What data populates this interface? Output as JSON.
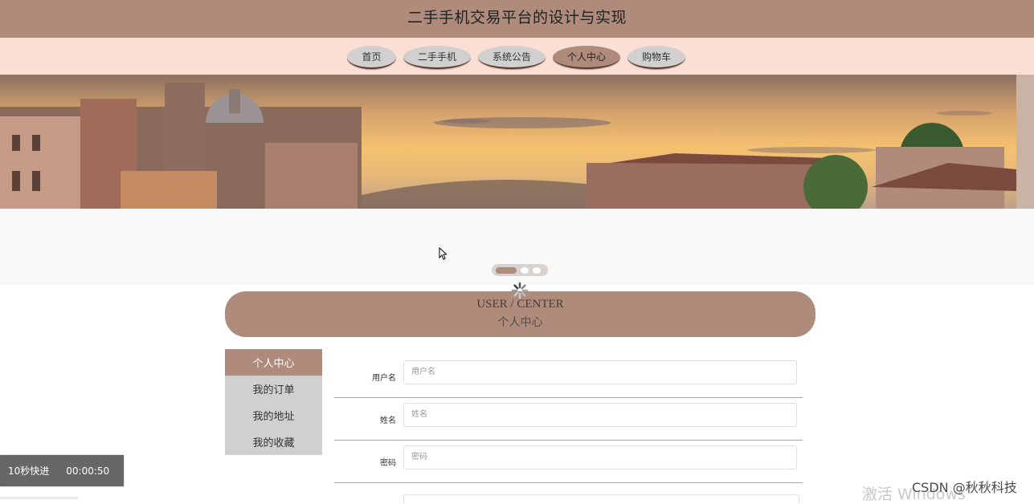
{
  "header": {
    "title": "二手手机交易平台的设计与实现"
  },
  "nav": {
    "items": [
      {
        "label": "首页"
      },
      {
        "label": "二手手机"
      },
      {
        "label": "系统公告"
      },
      {
        "label": "个人中心",
        "active": true
      },
      {
        "label": "购物车"
      }
    ]
  },
  "carousel": {
    "slide_count": 3,
    "active_index": 0
  },
  "section": {
    "title_en": "USER / CENTER",
    "title_cn": "个人中心"
  },
  "sidebar": {
    "items": [
      {
        "label": "个人中心",
        "active": true
      },
      {
        "label": "我的订单"
      },
      {
        "label": "我的地址"
      },
      {
        "label": "我的收藏"
      }
    ]
  },
  "form": {
    "fields": [
      {
        "label": "用户名",
        "placeholder": "用户名"
      },
      {
        "label": "姓名",
        "placeholder": "姓名"
      },
      {
        "label": "密码",
        "placeholder": "密码"
      }
    ]
  },
  "video_overlay": {
    "fast_forward": "10秒快进",
    "time": "00:00:50"
  },
  "watermark": {
    "activate": "激活 Windows",
    "csdn": "CSDN @秋秋科技"
  },
  "colors": {
    "accent": "#ae8b7b",
    "nav_bg": "#fcdfd4",
    "inactive": "#d0d0d0"
  }
}
